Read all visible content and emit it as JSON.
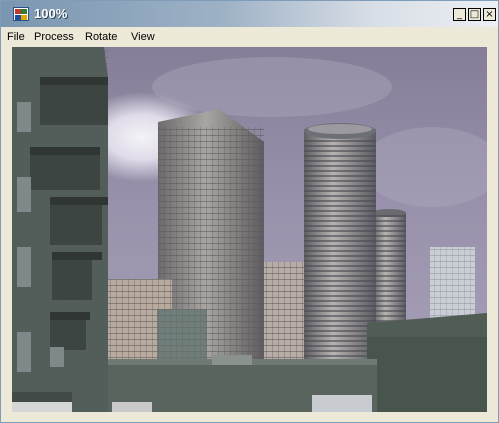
{
  "window": {
    "title": "100%",
    "icon": "app-image-icon",
    "controls": [
      {
        "name": "minimize-button",
        "glyph": "_",
        "icon": "minimize-icon"
      },
      {
        "name": "maximize-button",
        "glyph": "□",
        "icon": "maximize-icon"
      },
      {
        "name": "close-button",
        "glyph": "×",
        "icon": "close-icon"
      }
    ]
  },
  "menu": {
    "items": [
      "File",
      "Process",
      "Rotate",
      "View"
    ]
  },
  "image": {
    "subject": "city skyline photo",
    "colors": {
      "sky": "#8e86a0",
      "building_green": "#4e5e54",
      "tower": "#8c8a88"
    }
  }
}
